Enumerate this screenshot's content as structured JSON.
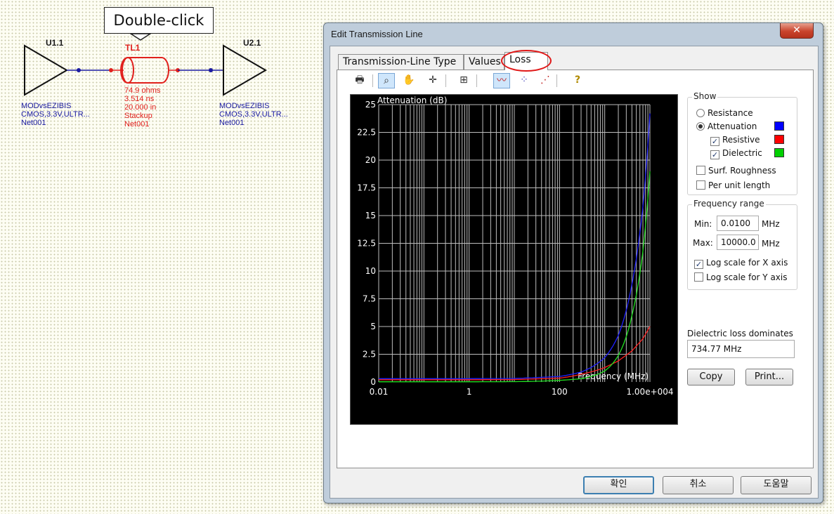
{
  "callout": "Double-click",
  "schematic": {
    "u1": {
      "ref": "U1.1",
      "lines": [
        "MODvsEZIBIS",
        "CMOS,3.3V,ULTR...",
        "Net001"
      ]
    },
    "tl1": {
      "ref": "TL1",
      "lines": [
        "74.9 ohms",
        "3.514 ns",
        "20.000 in",
        "Stackup",
        "Net001"
      ]
    },
    "u2": {
      "ref": "U2.1",
      "lines": [
        "MODvsEZIBIS",
        "CMOS,3.3V,ULTR...",
        "Net001"
      ]
    }
  },
  "dialog": {
    "title": "Edit Transmission Line",
    "close": "✕",
    "tabs": [
      "Transmission-Line Type",
      "Values",
      "Loss"
    ],
    "toolbar": [
      "printer-icon",
      "zoom-icon",
      "pan-hand-icon",
      "crosshair-icon",
      "fit-view-icon",
      "line-plot-icon",
      "scatter-plot-icon",
      "dashed-plot-icon",
      "help-icon"
    ],
    "show": {
      "title": "Show",
      "resistance": "Resistance",
      "attenuation": "Attenuation",
      "resistive": "Resistive",
      "dielectric": "Dielectric",
      "surf_roughness": "Surf. Roughness",
      "per_unit_length": "Per unit length",
      "colors": {
        "attenuation": "#0000ff",
        "resistive": "#ff0000",
        "dielectric": "#00d000"
      }
    },
    "freq": {
      "title": "Frequency range",
      "min_label": "Min:",
      "min_value": "0.0100",
      "max_label": "Max:",
      "max_value": "10000.0",
      "unit": "MHz",
      "log_x": "Log scale for X axis",
      "log_y": "Log scale for Y axis"
    },
    "dominates": {
      "label": "Dielectric loss dominates",
      "value": "734.77 MHz"
    },
    "copy": "Copy",
    "print": "Print...",
    "ok": "확인",
    "cancel": "취소",
    "help": "도움말"
  },
  "chart_data": {
    "type": "line",
    "title": "",
    "ylabel": "Attenuation (dB)",
    "xlabel": "Frequency (MHz)",
    "x_scale": "log",
    "xlim": [
      0.01,
      10000
    ],
    "ylim": [
      0,
      25
    ],
    "x_ticks": [
      "0.01",
      "1",
      "100",
      "1.00e+004"
    ],
    "y_ticks": [
      "0",
      "2.5",
      "5",
      "7.5",
      "10",
      "12.5",
      "15",
      "17.5",
      "20",
      "22.5",
      "25"
    ],
    "grid": true,
    "series": [
      {
        "color": "#2020ff",
        "x": [
          0.01,
          1,
          10,
          100,
          300,
          1000,
          2000,
          4000,
          7000,
          10000
        ],
        "y": [
          0.3,
          0.3,
          0.32,
          0.5,
          0.9,
          2.2,
          4.2,
          8.8,
          15.8,
          24.2
        ]
      },
      {
        "color": "#ff2020",
        "x": [
          0.01,
          1,
          10,
          100,
          300,
          1000,
          2000,
          4000,
          7000,
          10000
        ],
        "y": [
          0.2,
          0.2,
          0.22,
          0.35,
          0.7,
          1.3,
          1.9,
          2.8,
          3.9,
          5.0
        ]
      },
      {
        "color": "#20e020",
        "x": [
          0.01,
          1,
          10,
          100,
          300,
          1000,
          2000,
          4000,
          7000,
          10000
        ],
        "y": [
          0.02,
          0.02,
          0.03,
          0.15,
          0.3,
          1.0,
          2.4,
          6.0,
          11.8,
          19.0
        ]
      }
    ]
  }
}
